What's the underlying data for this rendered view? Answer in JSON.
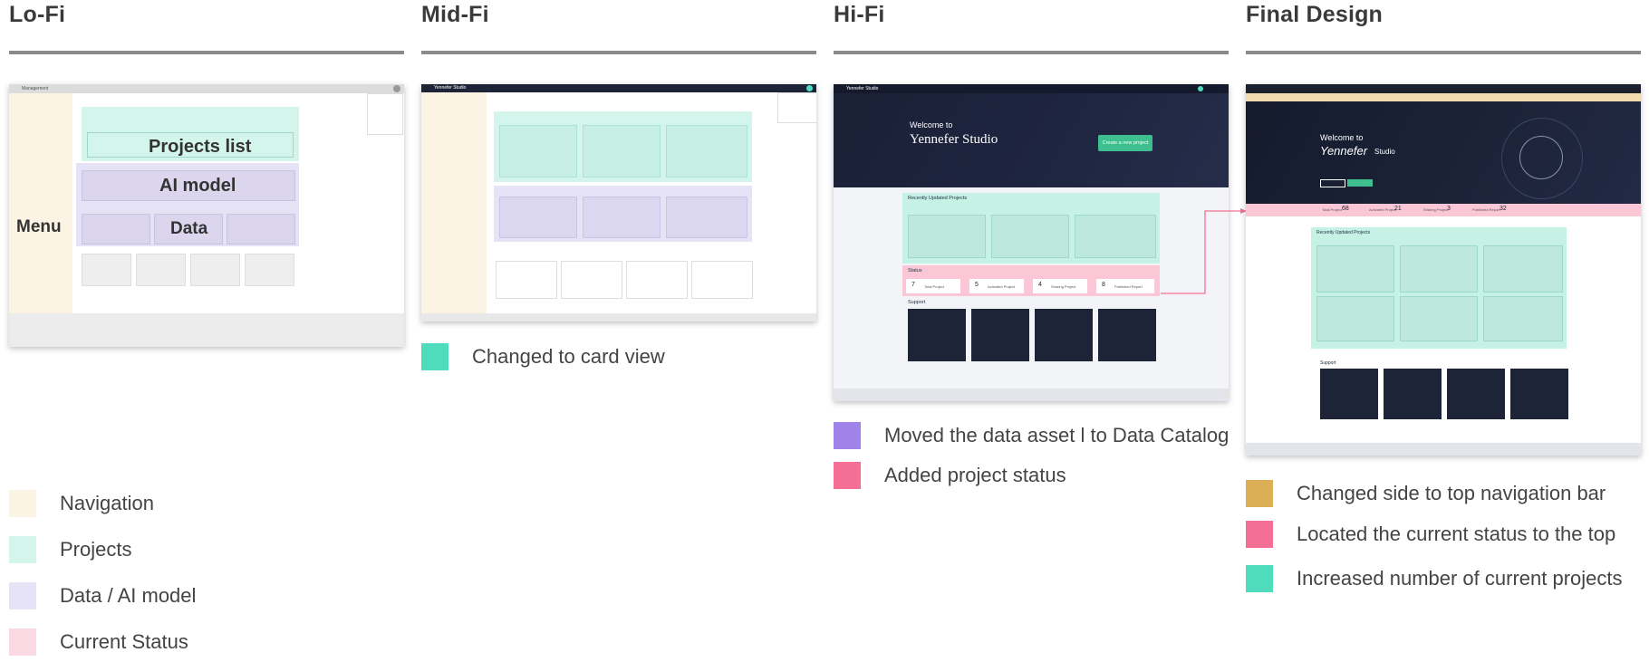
{
  "columns": {
    "lofi": {
      "title": "Lo-Fi",
      "app_name": "Management",
      "placeholders": {
        "projects": "Projects list",
        "ai": "AI model",
        "data": "Data",
        "menu": "Menu"
      }
    },
    "midfi": {
      "title": "Mid-Fi",
      "app_name": "Yennefer Studio"
    },
    "hifi": {
      "title": "Hi-Fi",
      "app_name": "Yennefer Studio",
      "welcome": "Welcome to",
      "studio": "Yennefer Studio",
      "create_button": "Create a new project",
      "recent_title": "Recently Updated Projects",
      "status_title": "Status",
      "support_title": "Support",
      "status_items": [
        {
          "value": "7",
          "label": "Total Project"
        },
        {
          "value": "5",
          "label": "Activated Project"
        },
        {
          "value": "4",
          "label": "Sharing Project"
        },
        {
          "value": "8",
          "label": "Published Report"
        }
      ]
    },
    "final": {
      "title": "Final Design",
      "welcome": "Welcome to",
      "studio_brand": "Yennefer",
      "studio_suffix": "Studio",
      "recent_title": "Recently Updated Projects",
      "support_title": "Support",
      "status_items": [
        {
          "label": "Total Project",
          "value": "68"
        },
        {
          "label": "Activated Project",
          "value": "21"
        },
        {
          "label": "Sharing Project",
          "value": "3"
        },
        {
          "label": "Published Report",
          "value": "32"
        }
      ]
    }
  },
  "legends": {
    "lofi": [
      {
        "label": "Navigation",
        "color": "#fbf3e4"
      },
      {
        "label": "Projects",
        "color": "#d4f5ec"
      },
      {
        "label": "Data / AI model",
        "color": "#e6e3f7"
      },
      {
        "label": "Current Status",
        "color": "#fbd9e3"
      }
    ],
    "midfi": [
      {
        "label": "Changed to card view",
        "color": "#4fdcbd"
      }
    ],
    "hifi": [
      {
        "label": "Moved the data asset l to Data Catalog",
        "color": "#a083e8"
      },
      {
        "label": "Added project status",
        "color": "#f56f95"
      }
    ],
    "final": [
      {
        "label": "Changed side to top navigation bar",
        "color": "#dcae55"
      },
      {
        "label": "Located the current status to the top",
        "color": "#f56f95"
      },
      {
        "label": "Increased number of current projects",
        "color": "#4fdcbd"
      }
    ]
  }
}
